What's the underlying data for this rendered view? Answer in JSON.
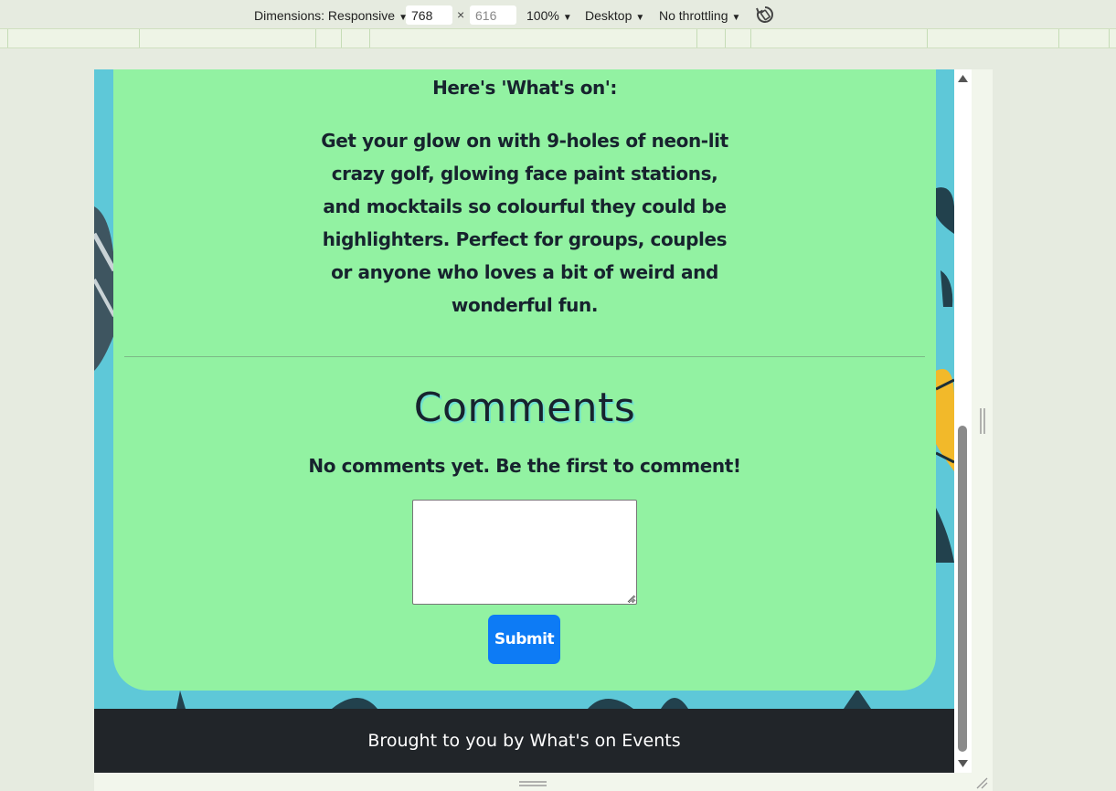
{
  "devtools": {
    "dimensions_label": "Dimensions: Responsive",
    "width_value": "768",
    "height_value": "616",
    "times": "×",
    "zoom": "100%",
    "device": "Desktop",
    "throttling": "No throttling",
    "caret": "▼",
    "rotate_icon": "rotate-icon"
  },
  "page": {
    "whats_on_heading": "Here's 'What's on':",
    "description": "Get your glow on with 9-holes of neon-lit crazy golf, glowing face paint stations, and mocktails so colourful they could be highlighters. Perfect for groups, couples or anyone who loves a bit of weird and wonderful fun.",
    "comments_title": "Comments",
    "no_comments": "No comments yet. Be the first to comment!",
    "comment_value": "",
    "submit_label": "Submit",
    "footer_text": "Brought to you by What's on Events"
  },
  "colors": {
    "card_bg": "#92f2a2",
    "page_bg": "#5ec8d8",
    "footer_bg": "#212529",
    "submit_bg": "#0d7bf5"
  }
}
